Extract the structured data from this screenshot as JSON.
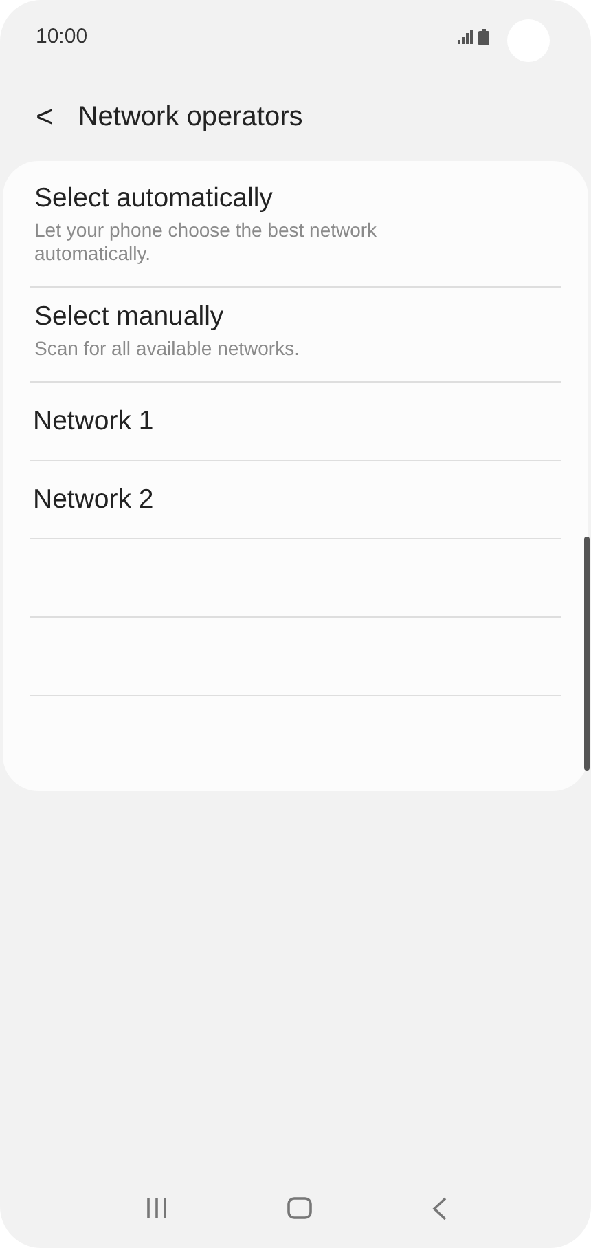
{
  "status_bar": {
    "time": "10:00"
  },
  "header": {
    "back": "<",
    "title": "Network operators"
  },
  "items": [
    {
      "kind": "option",
      "title": "Select automatically",
      "subtitle": "Let your phone choose the best network automatically."
    },
    {
      "kind": "option",
      "title": "Select manually",
      "subtitle": "Scan for all available networks."
    },
    {
      "kind": "network",
      "title": "Network 1"
    },
    {
      "kind": "network",
      "title": "Network 2"
    }
  ]
}
